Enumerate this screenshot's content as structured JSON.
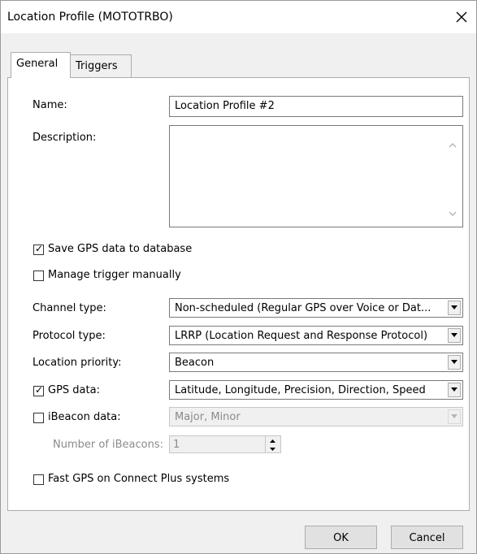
{
  "window": {
    "title": "Location Profile (MOTOTRBO)",
    "close_icon": "close-icon"
  },
  "tabs": [
    {
      "label": "General",
      "active": true
    },
    {
      "label": "Triggers",
      "active": false
    }
  ],
  "general": {
    "name_label": "Name:",
    "name_value": "Location Profile #2",
    "description_label": "Description:",
    "description_value": "",
    "save_gps": {
      "label": "Save GPS data to database",
      "checked": true
    },
    "manage_trigger": {
      "label": "Manage trigger manually",
      "checked": false
    },
    "channel_type": {
      "label": "Channel type:",
      "value": "Non-scheduled (Regular GPS over Voice or Dat..."
    },
    "protocol_type": {
      "label": "Protocol type:",
      "value": "LRRP (Location Request and Response Protocol)"
    },
    "location_priority": {
      "label": "Location priority:",
      "value": "Beacon"
    },
    "gps_data": {
      "label": "GPS data:",
      "checked": true,
      "value": "Latitude, Longitude, Precision, Direction, Speed"
    },
    "ibeacon_data": {
      "label": "iBeacon data:",
      "checked": false,
      "value": "Major, Minor",
      "disabled": true
    },
    "number_of_ibeacons": {
      "label": "Number of iBeacons:",
      "value": "1",
      "disabled": true
    },
    "fast_gps": {
      "label": "Fast GPS on Connect Plus systems",
      "checked": false
    }
  },
  "buttons": {
    "ok": "OK",
    "cancel": "Cancel"
  },
  "colors": {
    "window_bg": "#f0f0f0",
    "panel_bg": "#ffffff",
    "disabled_text": "#8b8b8b"
  }
}
